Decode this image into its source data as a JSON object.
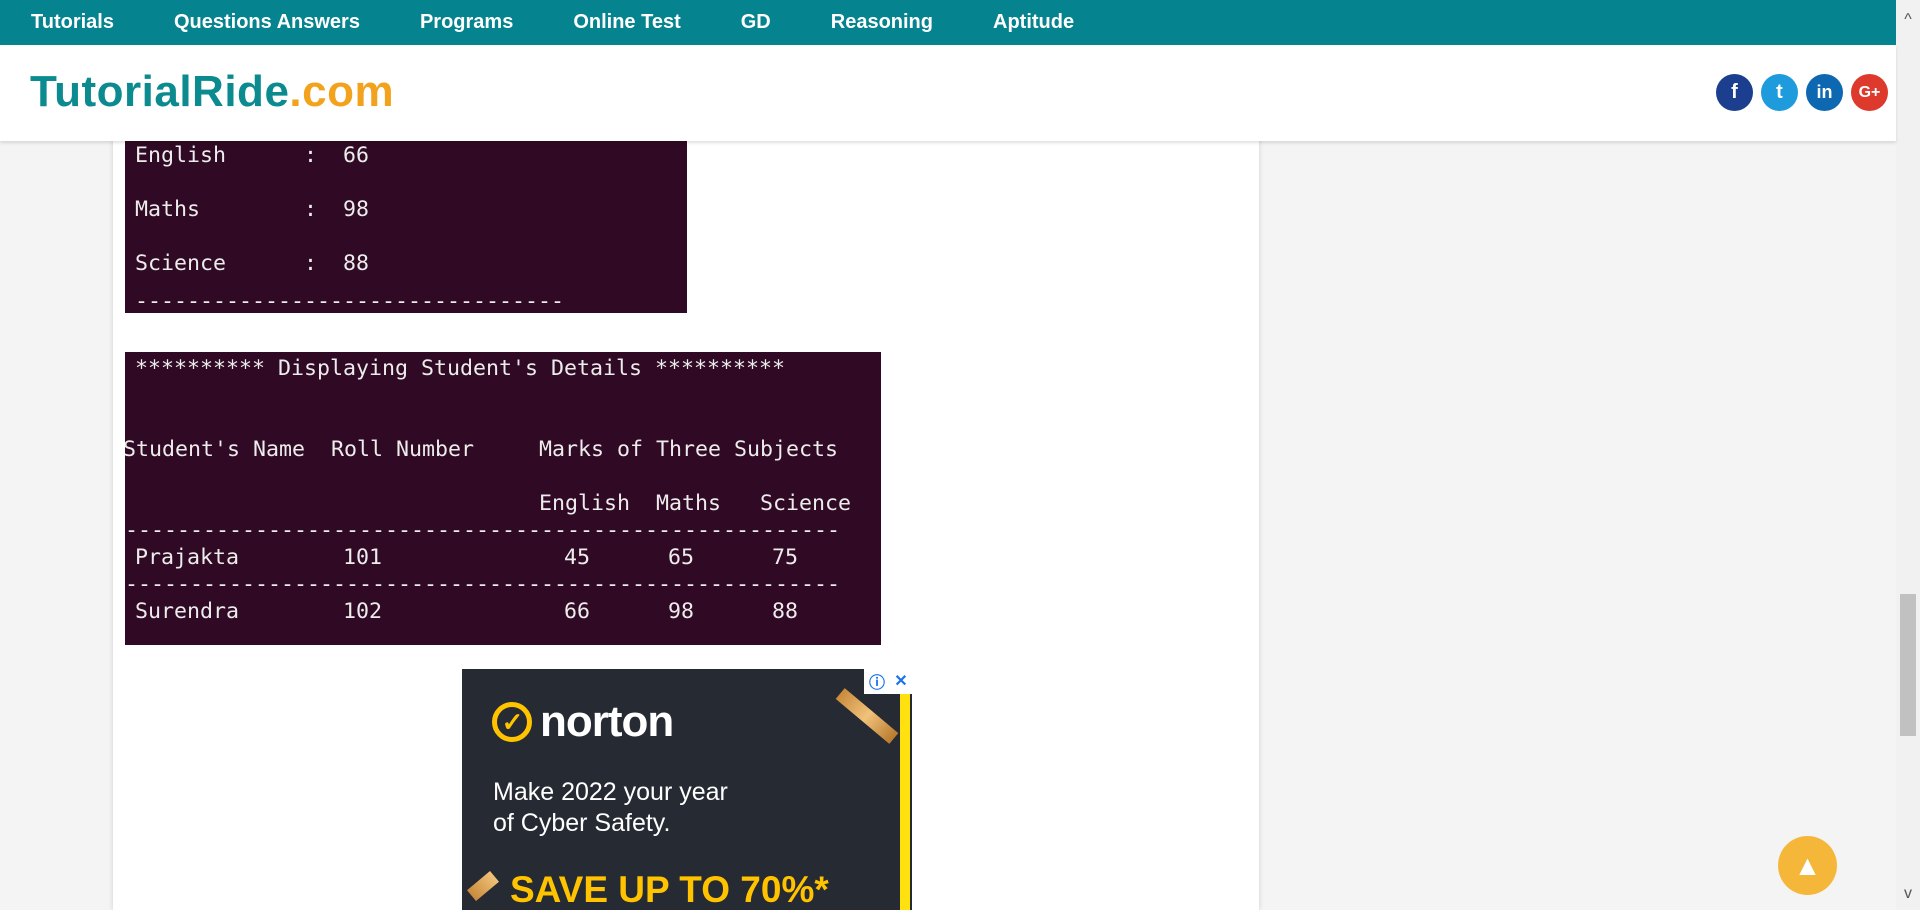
{
  "nav": {
    "items": [
      "Tutorials",
      "Questions Answers",
      "Programs",
      "Online Test",
      "GD",
      "Reasoning",
      "Aptitude"
    ]
  },
  "logo": {
    "main": "TutorialRide",
    "suffix": ".com"
  },
  "social": {
    "facebook": "f",
    "twitter": "t",
    "linkedin": "in",
    "googleplus": "G+"
  },
  "terminal1": {
    "lines": [
      "English      :  66",
      "Maths        :  98",
      "Science      :  88"
    ],
    "separator": "---------------------------------"
  },
  "terminal2": {
    "title": "********** Displaying Student's Details **********",
    "header1": "Student's Name  Roll Number     Marks of Three Subjects",
    "header2": "                                English  Maths   Science",
    "separator": "-------------------------------------------------------",
    "rows": [
      "Prajakta        101              45      65      75",
      "Surendra        102              66      98      88"
    ]
  },
  "ad": {
    "brand": "norton",
    "tagline": "Make 2022 your year\nof Cyber Safety.",
    "offer": "SAVE UP TO 70%*",
    "info_icon": "ⓘ",
    "close_icon": "✕"
  },
  "back_to_top": "▲",
  "scrollbar": {
    "up": "^",
    "down": "v"
  }
}
